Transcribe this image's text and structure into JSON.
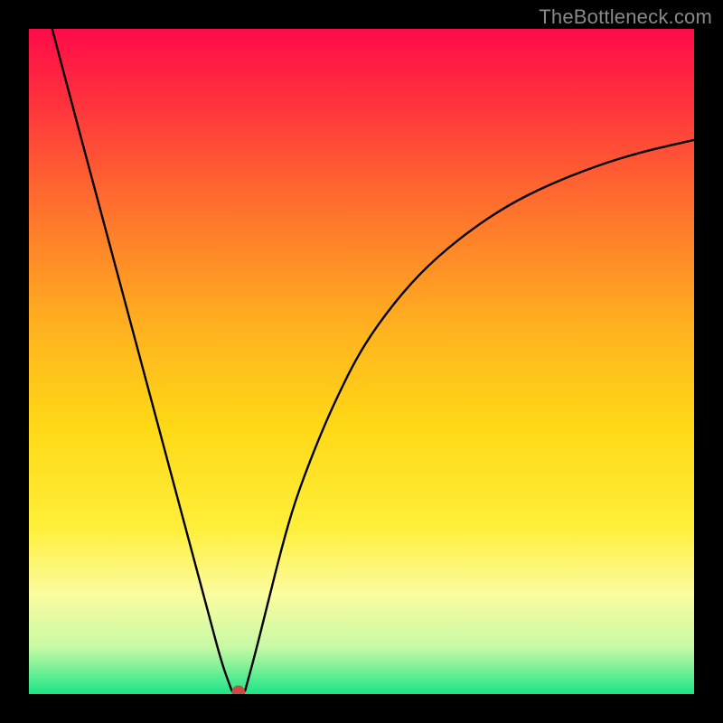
{
  "watermark": "TheBottleneck.com",
  "chart_data": {
    "type": "line",
    "title": "",
    "xlabel": "",
    "ylabel": "",
    "xlim": [
      0,
      100
    ],
    "ylim": [
      0,
      100
    ],
    "grid": false,
    "background_gradient_stops": [
      {
        "offset": 0.0,
        "color": "#ff0b49"
      },
      {
        "offset": 0.1,
        "color": "#ff2e3e"
      },
      {
        "offset": 0.25,
        "color": "#ff6a2f"
      },
      {
        "offset": 0.45,
        "color": "#ffb21f"
      },
      {
        "offset": 0.6,
        "color": "#ffd916"
      },
      {
        "offset": 0.75,
        "color": "#ffef3a"
      },
      {
        "offset": 0.85,
        "color": "#fcfca0"
      },
      {
        "offset": 0.93,
        "color": "#c7f9a5"
      },
      {
        "offset": 1.0,
        "color": "#1be587"
      }
    ],
    "series": [
      {
        "name": "left-branch",
        "x": [
          3.5,
          6,
          9,
          12,
          15,
          18,
          21,
          24,
          27,
          29,
          30.5
        ],
        "y": [
          100,
          90.5,
          79.3,
          68.1,
          56.9,
          45.7,
          34.5,
          23.3,
          12.1,
          4.6,
          0.5
        ]
      },
      {
        "name": "floor",
        "x": [
          30.5,
          31.5,
          32.5
        ],
        "y": [
          0.5,
          0.3,
          0.5
        ]
      },
      {
        "name": "right-branch",
        "x": [
          32.5,
          34,
          36,
          38,
          40,
          43,
          46,
          50,
          55,
          60,
          66,
          72,
          78,
          85,
          92,
          100
        ],
        "y": [
          0.5,
          6,
          14,
          22,
          29,
          37,
          44,
          52,
          59,
          64.5,
          69.5,
          73.5,
          76.5,
          79.3,
          81.5,
          83.3
        ]
      }
    ],
    "marker": {
      "x": 31.5,
      "y": 0.3,
      "color": "#c94b45",
      "r": 1.0
    }
  }
}
